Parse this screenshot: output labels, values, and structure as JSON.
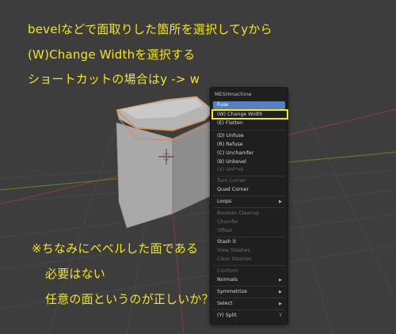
{
  "annotations": {
    "line1": "bevelなどで面取りした箇所を選択してyから",
    "line2": "(W)Change Widthを選択する",
    "line3": "ショートカットの場合はy -> w",
    "note1": "※ちなみにベベルした面である",
    "note2": "必要はない",
    "note3": "任意の面というのが正しいか？"
  },
  "menu": {
    "title": "MESHmachine",
    "items": {
      "fuse": "Fuse",
      "change_width": "(W) Change Width",
      "flatten": "(E) Flatten",
      "unfuse": "(D) Unfuse",
      "refuse": "(R) Refuse",
      "unchamfer": "(C) Unchamfer",
      "unbevel": "(B) Unbevel",
      "unf_ck": "(X) UnF*ck",
      "turn_corner": "Turn Corner",
      "quad_corner": "Quad Corner",
      "loops": "Loops",
      "boolean_cleanup": "Boolean Cleanup",
      "chamfer": "Chamfer",
      "offset": "Offset",
      "stash_it": "Stash it",
      "view_stashes": "View Stashes",
      "clear_stashes": "Clear Stashes",
      "conform": "Conform",
      "normals": "Normals",
      "symmetrize": "Symmetrize",
      "select": "Select",
      "split": "(Y) Split"
    },
    "split_shortcut": "Y"
  },
  "colors": {
    "annotation": "#f2e51f",
    "highlight": "#5680c2",
    "yellow_box": "#f5ea18",
    "background": "#3d3d3d"
  }
}
